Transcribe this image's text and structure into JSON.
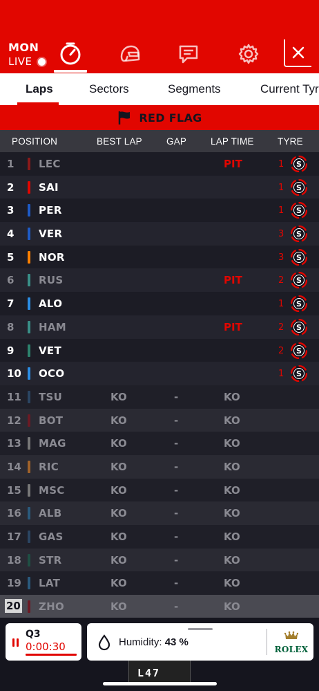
{
  "header": {
    "event_code": "MON",
    "live_label": "LIVE",
    "nav_icons": [
      "stopwatch-icon",
      "helmet-icon",
      "messages-icon",
      "gear-icon"
    ],
    "close_icon": "close-icon",
    "accent_color": "#e10600"
  },
  "tabs": [
    {
      "label": "Laps",
      "active": true
    },
    {
      "label": "Sectors",
      "active": false
    },
    {
      "label": "Segments",
      "active": false
    },
    {
      "label": "Current Tyre",
      "active": false
    }
  ],
  "flag_banner": {
    "label": "RED FLAG",
    "icon": "flag-icon"
  },
  "columns": {
    "position": "POSITION",
    "best_lap": "BEST LAP",
    "gap": "GAP",
    "lap_time": "LAP TIME",
    "tyre": "TYRE"
  },
  "rows": [
    {
      "pos": "1",
      "code": "LEC",
      "team_color": "#8b1a1a",
      "best": "",
      "gap": "",
      "lap_time": "PIT",
      "tyre_age": "1",
      "tyre": "S",
      "dim_text": true
    },
    {
      "pos": "2",
      "code": "SAI",
      "team_color": "#e10600",
      "best": "",
      "gap": "",
      "lap_time": "",
      "tyre_age": "1",
      "tyre": "S",
      "dim_text": false
    },
    {
      "pos": "3",
      "code": "PER",
      "team_color": "#1e5bc6",
      "best": "",
      "gap": "",
      "lap_time": "",
      "tyre_age": "1",
      "tyre": "S",
      "dim_text": false
    },
    {
      "pos": "4",
      "code": "VER",
      "team_color": "#1e5bc6",
      "best": "",
      "gap": "",
      "lap_time": "",
      "tyre_age": "3",
      "tyre": "S",
      "dim_text": false
    },
    {
      "pos": "5",
      "code": "NOR",
      "team_color": "#ff8000",
      "best": "",
      "gap": "",
      "lap_time": "",
      "tyre_age": "3",
      "tyre": "S",
      "dim_text": false
    },
    {
      "pos": "6",
      "code": "RUS",
      "team_color": "#3a8f87",
      "best": "",
      "gap": "",
      "lap_time": "PIT",
      "tyre_age": "2",
      "tyre": "S",
      "dim_text": true
    },
    {
      "pos": "7",
      "code": "ALO",
      "team_color": "#2b8de4",
      "best": "",
      "gap": "",
      "lap_time": "",
      "tyre_age": "1",
      "tyre": "S",
      "dim_text": false
    },
    {
      "pos": "8",
      "code": "HAM",
      "team_color": "#3a8f87",
      "best": "",
      "gap": "",
      "lap_time": "PIT",
      "tyre_age": "2",
      "tyre": "S",
      "dim_text": true
    },
    {
      "pos": "9",
      "code": "VET",
      "team_color": "#2d826d",
      "best": "",
      "gap": "",
      "lap_time": "",
      "tyre_age": "2",
      "tyre": "S",
      "dim_text": false
    },
    {
      "pos": "10",
      "code": "OCO",
      "team_color": "#2b8de4",
      "best": "",
      "gap": "",
      "lap_time": "",
      "tyre_age": "1",
      "tyre": "S",
      "dim_text": false
    },
    {
      "pos": "11",
      "code": "TSU",
      "team_color": "#2b4562",
      "best": "KO",
      "gap": "-",
      "lap_time": "KO",
      "tyre_age": "",
      "tyre": "",
      "dim_text": true
    },
    {
      "pos": "12",
      "code": "BOT",
      "team_color": "#6b1a24",
      "best": "KO",
      "gap": "-",
      "lap_time": "KO",
      "tyre_age": "",
      "tyre": "",
      "dim_text": true
    },
    {
      "pos": "13",
      "code": "MAG",
      "team_color": "#777777",
      "best": "KO",
      "gap": "-",
      "lap_time": "KO",
      "tyre_age": "",
      "tyre": "",
      "dim_text": true
    },
    {
      "pos": "14",
      "code": "RIC",
      "team_color": "#a0622a",
      "best": "KO",
      "gap": "-",
      "lap_time": "KO",
      "tyre_age": "",
      "tyre": "",
      "dim_text": true
    },
    {
      "pos": "15",
      "code": "MSC",
      "team_color": "#777777",
      "best": "KO",
      "gap": "-",
      "lap_time": "KO",
      "tyre_age": "",
      "tyre": "",
      "dim_text": true
    },
    {
      "pos": "16",
      "code": "ALB",
      "team_color": "#2a5a7d",
      "best": "KO",
      "gap": "-",
      "lap_time": "KO",
      "tyre_age": "",
      "tyre": "",
      "dim_text": true
    },
    {
      "pos": "17",
      "code": "GAS",
      "team_color": "#2b4562",
      "best": "KO",
      "gap": "-",
      "lap_time": "KO",
      "tyre_age": "",
      "tyre": "",
      "dim_text": true
    },
    {
      "pos": "18",
      "code": "STR",
      "team_color": "#1f4f44",
      "best": "KO",
      "gap": "-",
      "lap_time": "KO",
      "tyre_age": "",
      "tyre": "",
      "dim_text": true
    },
    {
      "pos": "19",
      "code": "LAT",
      "team_color": "#2a5a7d",
      "best": "KO",
      "gap": "-",
      "lap_time": "KO",
      "tyre_age": "",
      "tyre": "",
      "dim_text": true
    },
    {
      "pos": "20",
      "code": "ZHO",
      "team_color": "#6b1a24",
      "best": "KO",
      "gap": "-",
      "lap_time": "KO",
      "tyre_age": "",
      "tyre": "",
      "dim_text": true,
      "selected": true
    }
  ],
  "session": {
    "name": "Q3",
    "clock": "0:00:30",
    "icon": "pause-icon"
  },
  "weather": {
    "label": "Humidity:",
    "value": "43 %",
    "icon": "droplet-icon"
  },
  "sponsor": {
    "name": "ROLEX",
    "icon": "crown-icon",
    "color": "#006039"
  },
  "car_number": "L47"
}
